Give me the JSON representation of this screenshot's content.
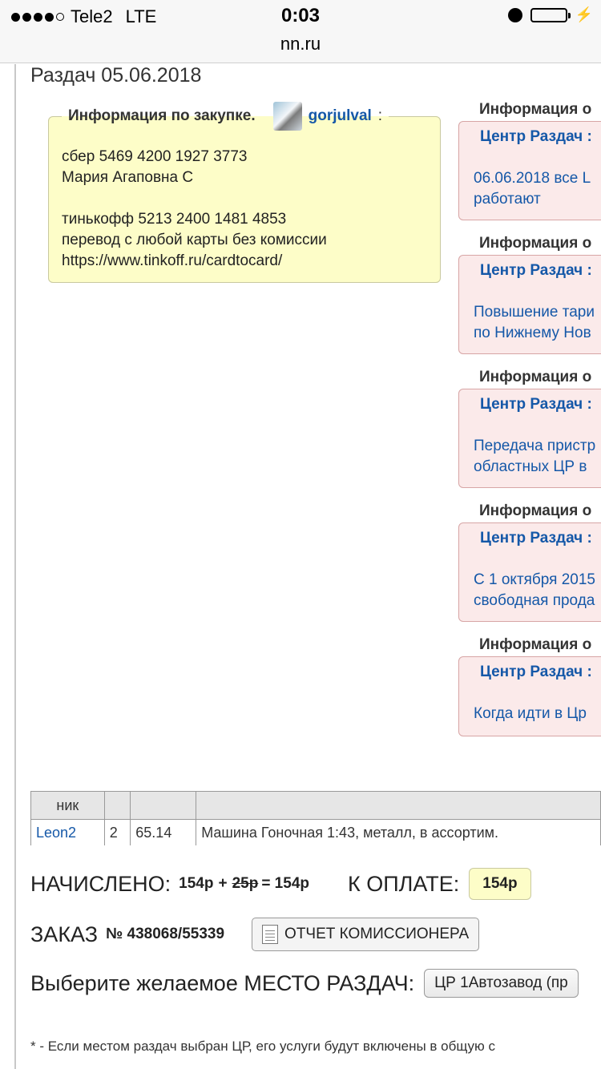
{
  "status_bar": {
    "carrier": "Tele2",
    "network": "LTE",
    "time": "0:03"
  },
  "url_bar": {
    "domain": "nn.ru"
  },
  "page": {
    "title": "Раздач 05.06.2018"
  },
  "purchase_info": {
    "legend_label": "Информация по закупке.",
    "username": "gorjulval",
    "colon": ":",
    "lines": [
      "сбер 5469 4200 1927 3773",
      "Мария Агаповна С",
      "",
      "тинькофф 5213 2400 1481 4853",
      "перевод с любой карты без комиссии",
      "https://www.tinkoff.ru/cardtocard/"
    ]
  },
  "right_info": [
    {
      "heading": "Информация о",
      "source": "Центр Раздач :",
      "text_line1": "06.06.2018 все L",
      "text_line2": "работают"
    },
    {
      "heading": "Информация о",
      "source": "Центр Раздач :",
      "text_line1": "Повышение тари",
      "text_line2": "по Нижнему Нов"
    },
    {
      "heading": "Информация о",
      "source": "Центр Раздач :",
      "text_line1": "Передача пристр",
      "text_line2": "областных ЦР в"
    },
    {
      "heading": "Информация о",
      "source": "Центр Раздач :",
      "text_line1": "С 1 октября 2015",
      "text_line2": "свободная прода"
    },
    {
      "heading": "Информация о",
      "source": "Центр Раздач :",
      "text_line1": "Когда идти в Цр",
      "text_line2": ""
    }
  ],
  "orders_table": {
    "headers": [
      "ник",
      "",
      "",
      ""
    ],
    "rows": [
      {
        "nick": "Leon2",
        "qty": "2",
        "price": "65.14",
        "item": "Машина Гоночная 1:43, металл, в ассортим."
      }
    ]
  },
  "summary": {
    "charged_label": "НАЧИСЛЕНО:",
    "charged_amount": "154р",
    "plus": "+",
    "fee": "25р",
    "equals_total": "= 154р",
    "to_pay_label": "К ОПЛАТЕ:",
    "to_pay_amount": "154р"
  },
  "order": {
    "label": "ЗАКАЗ",
    "number": "№ 438068/55339",
    "report_button": "ОТЧЕТ КОМИССИОНЕРА"
  },
  "pickup": {
    "label": "Выберите желаемое МЕСТО РАЗДАЧ:",
    "selected": "ЦР 1Автозавод (пр"
  },
  "footnote": "* - Если местом раздач выбран ЦР, его услуги будут включены в общую с"
}
